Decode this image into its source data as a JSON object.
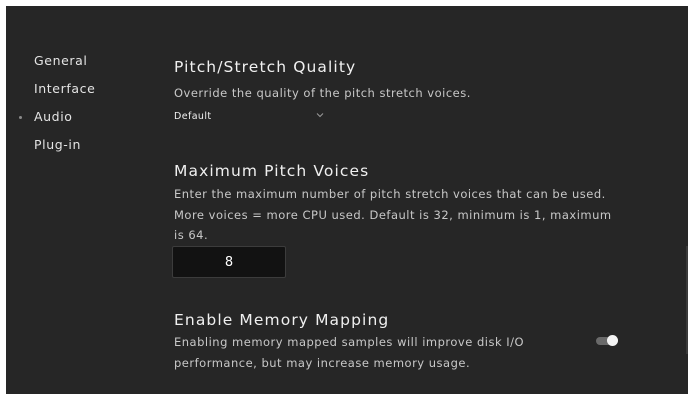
{
  "sidebar": {
    "items": [
      {
        "label": "General"
      },
      {
        "label": "Interface"
      },
      {
        "label": "Audio"
      },
      {
        "label": "Plug-in"
      }
    ]
  },
  "sections": {
    "pitch_quality": {
      "title": "Pitch/Stretch Quality",
      "description": "Override the quality of the pitch stretch voices.",
      "selected_value": "Default"
    },
    "max_voices": {
      "title": "Maximum Pitch Voices",
      "description": "Enter the maximum number of pitch stretch voices that can be used. More voices = more CPU used. Default is 32, minimum is 1, maximum is 64.",
      "value": "8"
    },
    "memory_mapping": {
      "title": "Enable Memory Mapping",
      "description": "Enabling memory mapped samples will improve disk I/O performance, but may increase memory usage.",
      "enabled": true
    }
  },
  "colors": {
    "background": "#262626",
    "input_background": "#121212",
    "toggle_track": "#6a6a6a",
    "toggle_knob": "#f4f4f4"
  }
}
